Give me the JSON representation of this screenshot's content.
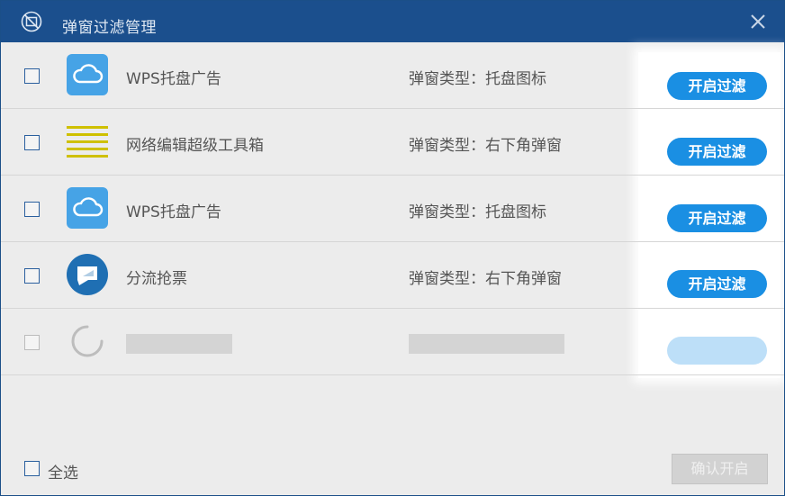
{
  "window": {
    "title": "弹窗过滤管理",
    "close_glyph": "×"
  },
  "rows": [
    {
      "name": "WPS托盘广告",
      "type": "弹窗类型：托盘图标",
      "action": "开启过滤",
      "icon": "cloud-icon"
    },
    {
      "name": "网络编辑超级工具箱",
      "type": "弹窗类型：右下角弹窗",
      "action": "开启过滤",
      "icon": "stripes-icon"
    },
    {
      "name": "WPS托盘广告",
      "type": "弹窗类型：托盘图标",
      "action": "开启过滤",
      "icon": "cloud-icon"
    },
    {
      "name": "分流抢票",
      "type": "弹窗类型：右下角弹窗",
      "action": "开启过滤",
      "icon": "monitor-icon"
    }
  ],
  "loading_row": {
    "icon": "spinner-icon"
  },
  "footer": {
    "select_all_label": "全选",
    "confirm_label": "确认开启"
  },
  "colors": {
    "titlebar": "#1b4f8d",
    "accent_button": "#1a8fe3",
    "cloud_icon_bg": "#46a3e6",
    "stripes_icon": "#cfc000",
    "monitor_icon_bg": "#1f6fb3"
  }
}
